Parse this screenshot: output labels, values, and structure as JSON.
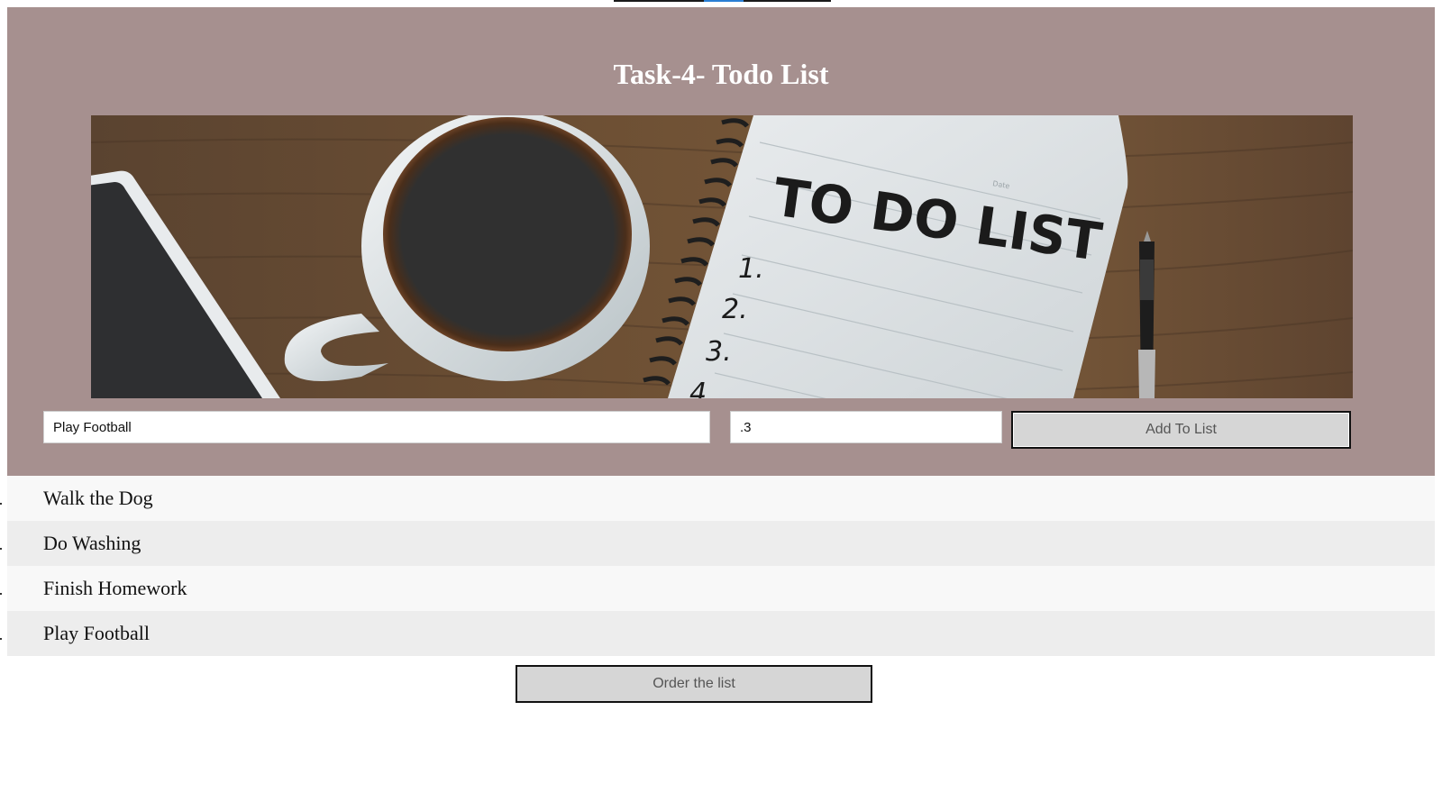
{
  "header": {
    "title": "Task-4- Todo List",
    "background_color": "#a6908f"
  },
  "banner": {
    "image_name": "todo-list-banner-image",
    "notebook_text": "TO DO LIST",
    "notebook_numbers": [
      "1.",
      "2.",
      "3.",
      "4"
    ],
    "notebook_date_label": "Date"
  },
  "form": {
    "task_value": "Play Football",
    "priority_value": ".3",
    "add_label": "Add To List"
  },
  "todos": [
    {
      "text": "Walk the Dog"
    },
    {
      "text": "Do Washing"
    },
    {
      "text": "Finish Homework"
    },
    {
      "text": "Play Football"
    }
  ],
  "order_label": "Order the list",
  "colors": {
    "row_odd": "#f8f8f8",
    "row_even": "#ededed",
    "button_bg": "#d6d6d6"
  }
}
